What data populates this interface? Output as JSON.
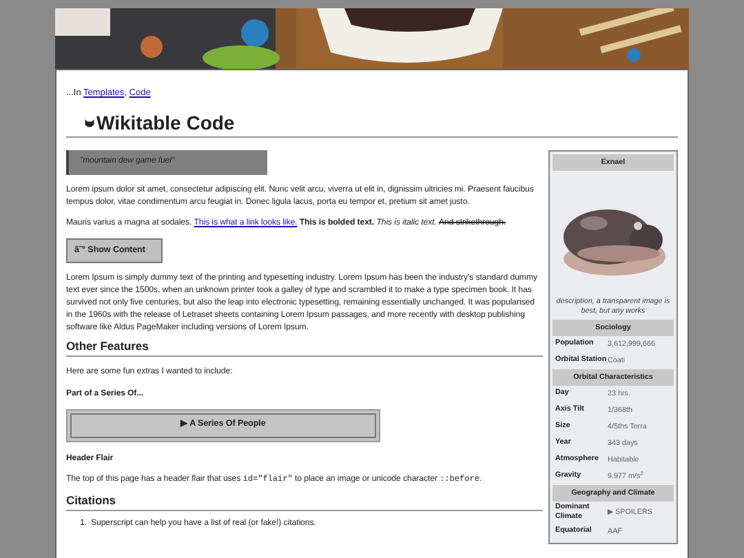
{
  "breadcrumb": {
    "prefix": "...In",
    "links": [
      {
        "label": "Templates",
        "suffix": ","
      },
      {
        "label": "Code"
      }
    ]
  },
  "title": "Wikitable Code",
  "quote": "\"mountain dew game fuel\"",
  "paragraphs": [
    {
      "segments": [
        {
          "kind": "text",
          "text": "Lorem ipsum dolor sit amet, consectetur adipiscing elit. Nunc velit arcu, viverra ut elit in, dignissim ultricies mi. Praesent faucibus tempus dolor, vitae condimentum arcu feugiat in. Donec ligula lacus, porta eu tempor et, pretium sit amet justo."
        }
      ]
    },
    {
      "segments": [
        {
          "kind": "text",
          "text": "Mauris varius a magna at sodales. "
        },
        {
          "kind": "link",
          "text": "This is what a link looks like."
        },
        {
          "kind": "bold",
          "text": " This is bolded text."
        },
        {
          "kind": "italic",
          "text": " This is italic text. "
        },
        {
          "kind": "strike",
          "text": "And strikethrough."
        }
      ]
    }
  ],
  "show_button": "â˜° Show Content",
  "lorem": "Lorem Ipsum is simply dummy text of the printing and typesetting industry. Lorem Ipsum has been the industry's standard dummy text ever since the 1500s, when an unknown printer took a galley of type and scrambled it to make a type specimen book. It has survived not only five centuries, but also the leap into electronic typesetting, remaining essentially unchanged. It was popularised in the 1960s with the release of Letraset sheets containing Lorem Ipsum passages, and more recently with desktop publishing software like Aldus PageMaker including versions of Lorem Ipsum.",
  "other_features": {
    "heading": "Other Features",
    "intro": "Here are some fun extras I wanted to include:",
    "series_label": "Part of a Series Of...",
    "series_toggle": "▶ A Series Of People",
    "flair_heading": "Header Flair",
    "flair_text": [
      {
        "kind": "text",
        "text": "The top of this page has a header flair that uses "
      },
      {
        "kind": "code",
        "text": "id=\"flair\""
      },
      {
        "kind": "text",
        "text": " to place an image or unicode character "
      },
      {
        "kind": "code",
        "text": "::before"
      },
      {
        "kind": "text",
        "text": "."
      }
    ]
  },
  "citations": {
    "heading": "Citations",
    "items": [
      {
        "number": "1.",
        "text": "Superscript can help you have a list of real (or fake!) citations."
      }
    ]
  },
  "infobox": {
    "title": "Exnael",
    "caption": "description, a transparent image is best, but any works",
    "sections": [
      {
        "heading": "Sociology",
        "rows": [
          {
            "label": "Population",
            "value": "3,612,999,666"
          },
          {
            "label": "Orbital Station",
            "value": "Coati"
          }
        ]
      },
      {
        "heading": "Orbital Characteristics",
        "rows": [
          {
            "label": "Day",
            "value": "23 hrs."
          },
          {
            "label": "Axis Tilt",
            "value": "1/368th"
          },
          {
            "label": "Size",
            "value": "4/5ths Terra"
          },
          {
            "label": "Year",
            "value": "343 days"
          },
          {
            "label": "Atmosphere",
            "value": "Habitable"
          },
          {
            "label": "Gravity",
            "value": "9.977 m/s$^{2}$"
          }
        ]
      },
      {
        "heading": "Geography and Climate",
        "rows": [
          {
            "label": "Dominant Climate",
            "value": "▶ SPOILERS"
          },
          {
            "label": "Equatorial",
            "value": "AAF"
          }
        ]
      }
    ]
  }
}
